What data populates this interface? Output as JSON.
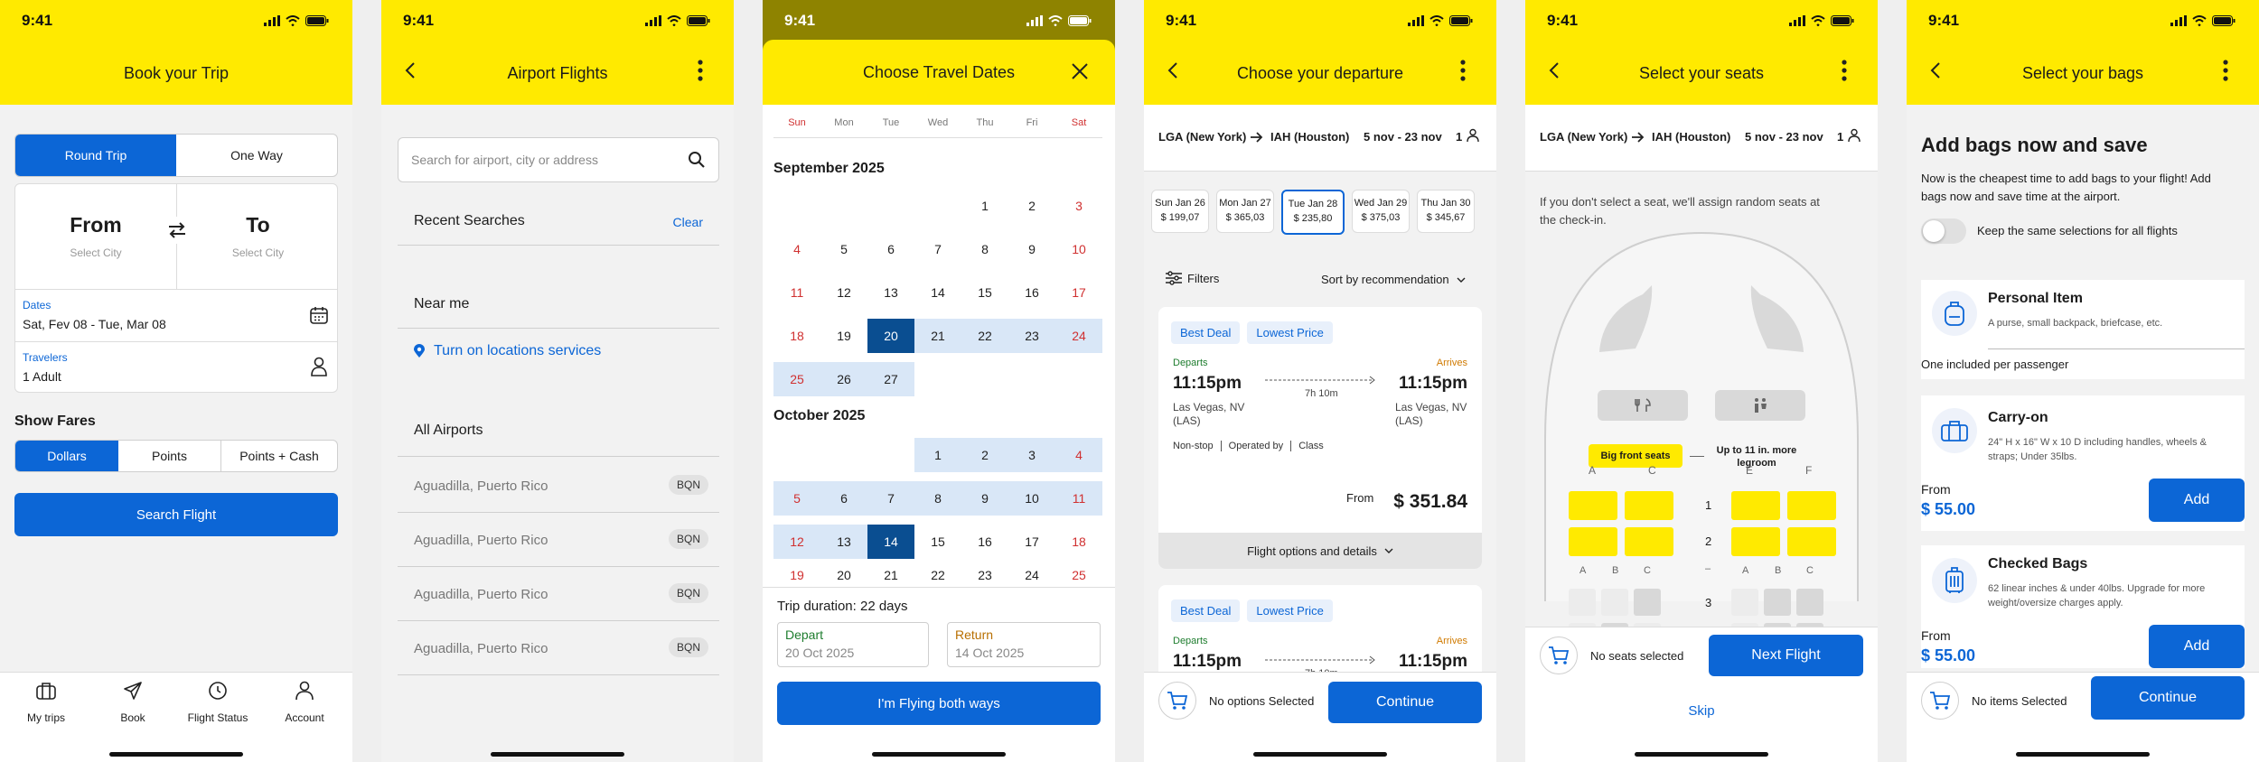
{
  "status_time": "9:41",
  "colors": {
    "brand_yellow": "#ffea00",
    "primary_blue": "#0c66d6",
    "selected_date": "#0a4e91",
    "range_fill": "#d9e7f7",
    "weekend_red": "#d03030"
  },
  "s1": {
    "title": "Book your Trip",
    "trip_tabs": [
      "Round Trip",
      "One Way"
    ],
    "from_label": "From",
    "from_sub": "Select City",
    "to_label": "To",
    "to_sub": "Select City",
    "dates_label": "Dates",
    "dates_value": "Sat, Fev 08 - Tue, Mar 08",
    "travelers_label": "Travelers",
    "travelers_value": "1 Adult",
    "fares_title": "Show Fares",
    "fare_tabs": [
      "Dollars",
      "Points",
      "Points + Cash"
    ],
    "search_button": "Search Flight",
    "nav": [
      {
        "label": "My trips",
        "icon": "suitcase-icon"
      },
      {
        "label": "Book",
        "icon": "plane-icon"
      },
      {
        "label": "Flight Status",
        "icon": "clock-icon"
      },
      {
        "label": "Account",
        "icon": "person-icon"
      }
    ]
  },
  "s2": {
    "title": "Airport Flights",
    "search_placeholder": "Search for airport, city or address",
    "recent_title": "Recent Searches",
    "clear": "Clear",
    "near_me": "Near me",
    "location_link": "Turn on locations services",
    "all_airports": "All Airports",
    "airports": [
      {
        "name": "Aguadilla, Puerto Rico",
        "code": "BQN"
      },
      {
        "name": "Aguadilla, Puerto Rico",
        "code": "BQN"
      },
      {
        "name": "Aguadilla, Puerto Rico",
        "code": "BQN"
      },
      {
        "name": "Aguadilla, Puerto Rico",
        "code": "BQN"
      }
    ]
  },
  "s3": {
    "title": "Choose Travel Dates",
    "weekdays": [
      "Sun",
      "Mon",
      "Tue",
      "Wed",
      "Thu",
      "Fri",
      "Sat"
    ],
    "month1": "September 2025",
    "month2": "October 2025",
    "trip_duration": "Trip duration: 22 days",
    "depart_label": "Depart",
    "depart_value": "20 Oct 2025",
    "return_label": "Return",
    "return_value": "14 Oct 2025",
    "button": "I'm Flying both ways"
  },
  "s4": {
    "title": "Choose your departure",
    "route_from": "LGA (New York)",
    "route_to": "IAH (Houston)",
    "route_dates": "5 nov - 23 nov",
    "pax": "1",
    "date_chips": [
      {
        "day": "Sun Jan 26",
        "price": "$ 199,07"
      },
      {
        "day": "Mon Jan 27",
        "price": "$ 365,03"
      },
      {
        "day": "Tue Jan 28",
        "price": "$ 235,80"
      },
      {
        "day": "Wed Jan 29",
        "price": "$ 375,03"
      },
      {
        "day": "Thu Jan 30",
        "price": "$ 345,67"
      }
    ],
    "filters": "Filters",
    "sort": "Sort by recommendation",
    "tags": [
      "Best Deal",
      "Lowest Price"
    ],
    "departs": "Departs",
    "arrives": "Arrives",
    "dep_time": "11:15pm",
    "arr_time": "11:15pm",
    "duration": "7h 10m",
    "dep_city": "Las Vegas, NV",
    "dep_code": "(LAS)",
    "arr_city": "Las Vegas, NV",
    "arr_code": "(LAS)",
    "meta": [
      "Non-stop",
      "Operated by",
      "Class"
    ],
    "from": "From",
    "price": "$ 351.84",
    "details": "Flight options and details",
    "card2_duration": "7h 10m",
    "no_options": "No options Selected",
    "continue": "Continue"
  },
  "s5": {
    "title": "Select your seats",
    "route_from": "LGA (New York)",
    "route_to": "IAH (Houston)",
    "route_dates": "5 nov - 23 nov",
    "pax": "1",
    "note": "If you don't select a seat, we'll assign random seats at the check-in.",
    "big_front": "Big front seats",
    "legroom": "Up to 11 in. more legroom",
    "col_top": [
      "A",
      "C",
      "E",
      "F"
    ],
    "rows": [
      "1",
      "2",
      "–",
      "3"
    ],
    "col_mid": [
      "A",
      "B",
      "C",
      "A",
      "B",
      "C"
    ],
    "no_seats": "No seats selected",
    "next": "Next Flight",
    "skip": "Skip"
  },
  "s6": {
    "title": "Select your bags",
    "heading": "Add bags now and save",
    "sub": "Now is the cheapest time to add bags to your flight! Add bags now and save time at the airport.",
    "toggle_label": "Keep the same selections for all flights",
    "personal_title": "Personal Item",
    "personal_desc": "A purse, small backpack, briefcase, etc.",
    "personal_note": "One included per passenger",
    "carry_title": "Carry-on",
    "carry_desc": "24\" H x 16\" W x 10 D including handles, wheels & straps; Under 35lbs.",
    "carry_from": "From",
    "carry_price": "$ 55.00",
    "add": "Add",
    "checked_title": "Checked Bags",
    "checked_desc": "62 linear inches & under 40lbs. Upgrade for more weight/oversize charges apply.",
    "checked_from": "From",
    "checked_price": "$ 55.00",
    "no_items": "No items Selected",
    "continue": "Continue"
  }
}
